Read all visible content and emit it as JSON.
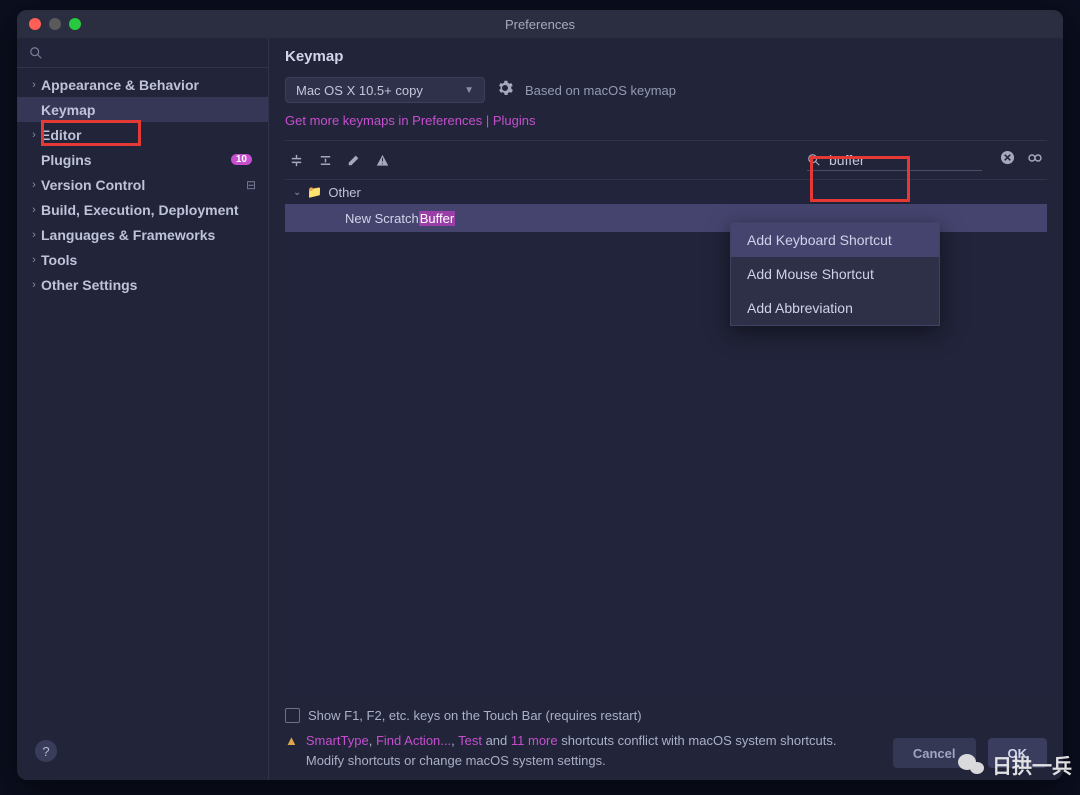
{
  "window": {
    "title": "Preferences"
  },
  "sidebar": {
    "items": [
      {
        "label": "Appearance & Behavior",
        "expandable": true
      },
      {
        "label": "Keymap",
        "selected": true
      },
      {
        "label": "Editor",
        "expandable": true
      },
      {
        "label": "Plugins",
        "badge": "10"
      },
      {
        "label": "Version Control",
        "expandable": true,
        "repo_icon": true
      },
      {
        "label": "Build, Execution, Deployment",
        "expandable": true
      },
      {
        "label": "Languages & Frameworks",
        "expandable": true
      },
      {
        "label": "Tools",
        "expandable": true
      },
      {
        "label": "Other Settings",
        "expandable": true
      }
    ]
  },
  "main": {
    "title": "Keymap",
    "scheme": "Mac OS X 10.5+ copy",
    "based_on": "Based on macOS keymap",
    "more_link": "Get more keymaps in Preferences | Plugins",
    "search_value": "buffer",
    "tree": {
      "group": "Other",
      "action_prefix": "New Scratch ",
      "action_match": "Buffer"
    },
    "context_menu": {
      "items": [
        "Add Keyboard Shortcut",
        "Add Mouse Shortcut",
        "Add Abbreviation"
      ],
      "selected_index": 0
    },
    "touchbar_checkbox": "Show F1, F2, etc. keys on the Touch Bar (requires restart)",
    "conflict": {
      "link1": "SmartType",
      "sep1": ", ",
      "link2": "Find Action...",
      "sep2": ", ",
      "link3": "Test",
      "mid": " and ",
      "link4": "11 more",
      "tail": " shortcuts conflict with macOS system shortcuts.",
      "line2": "Modify shortcuts or change macOS system settings."
    }
  },
  "buttons": {
    "cancel": "Cancel",
    "ok": "OK"
  },
  "watermark": "日拱一兵"
}
